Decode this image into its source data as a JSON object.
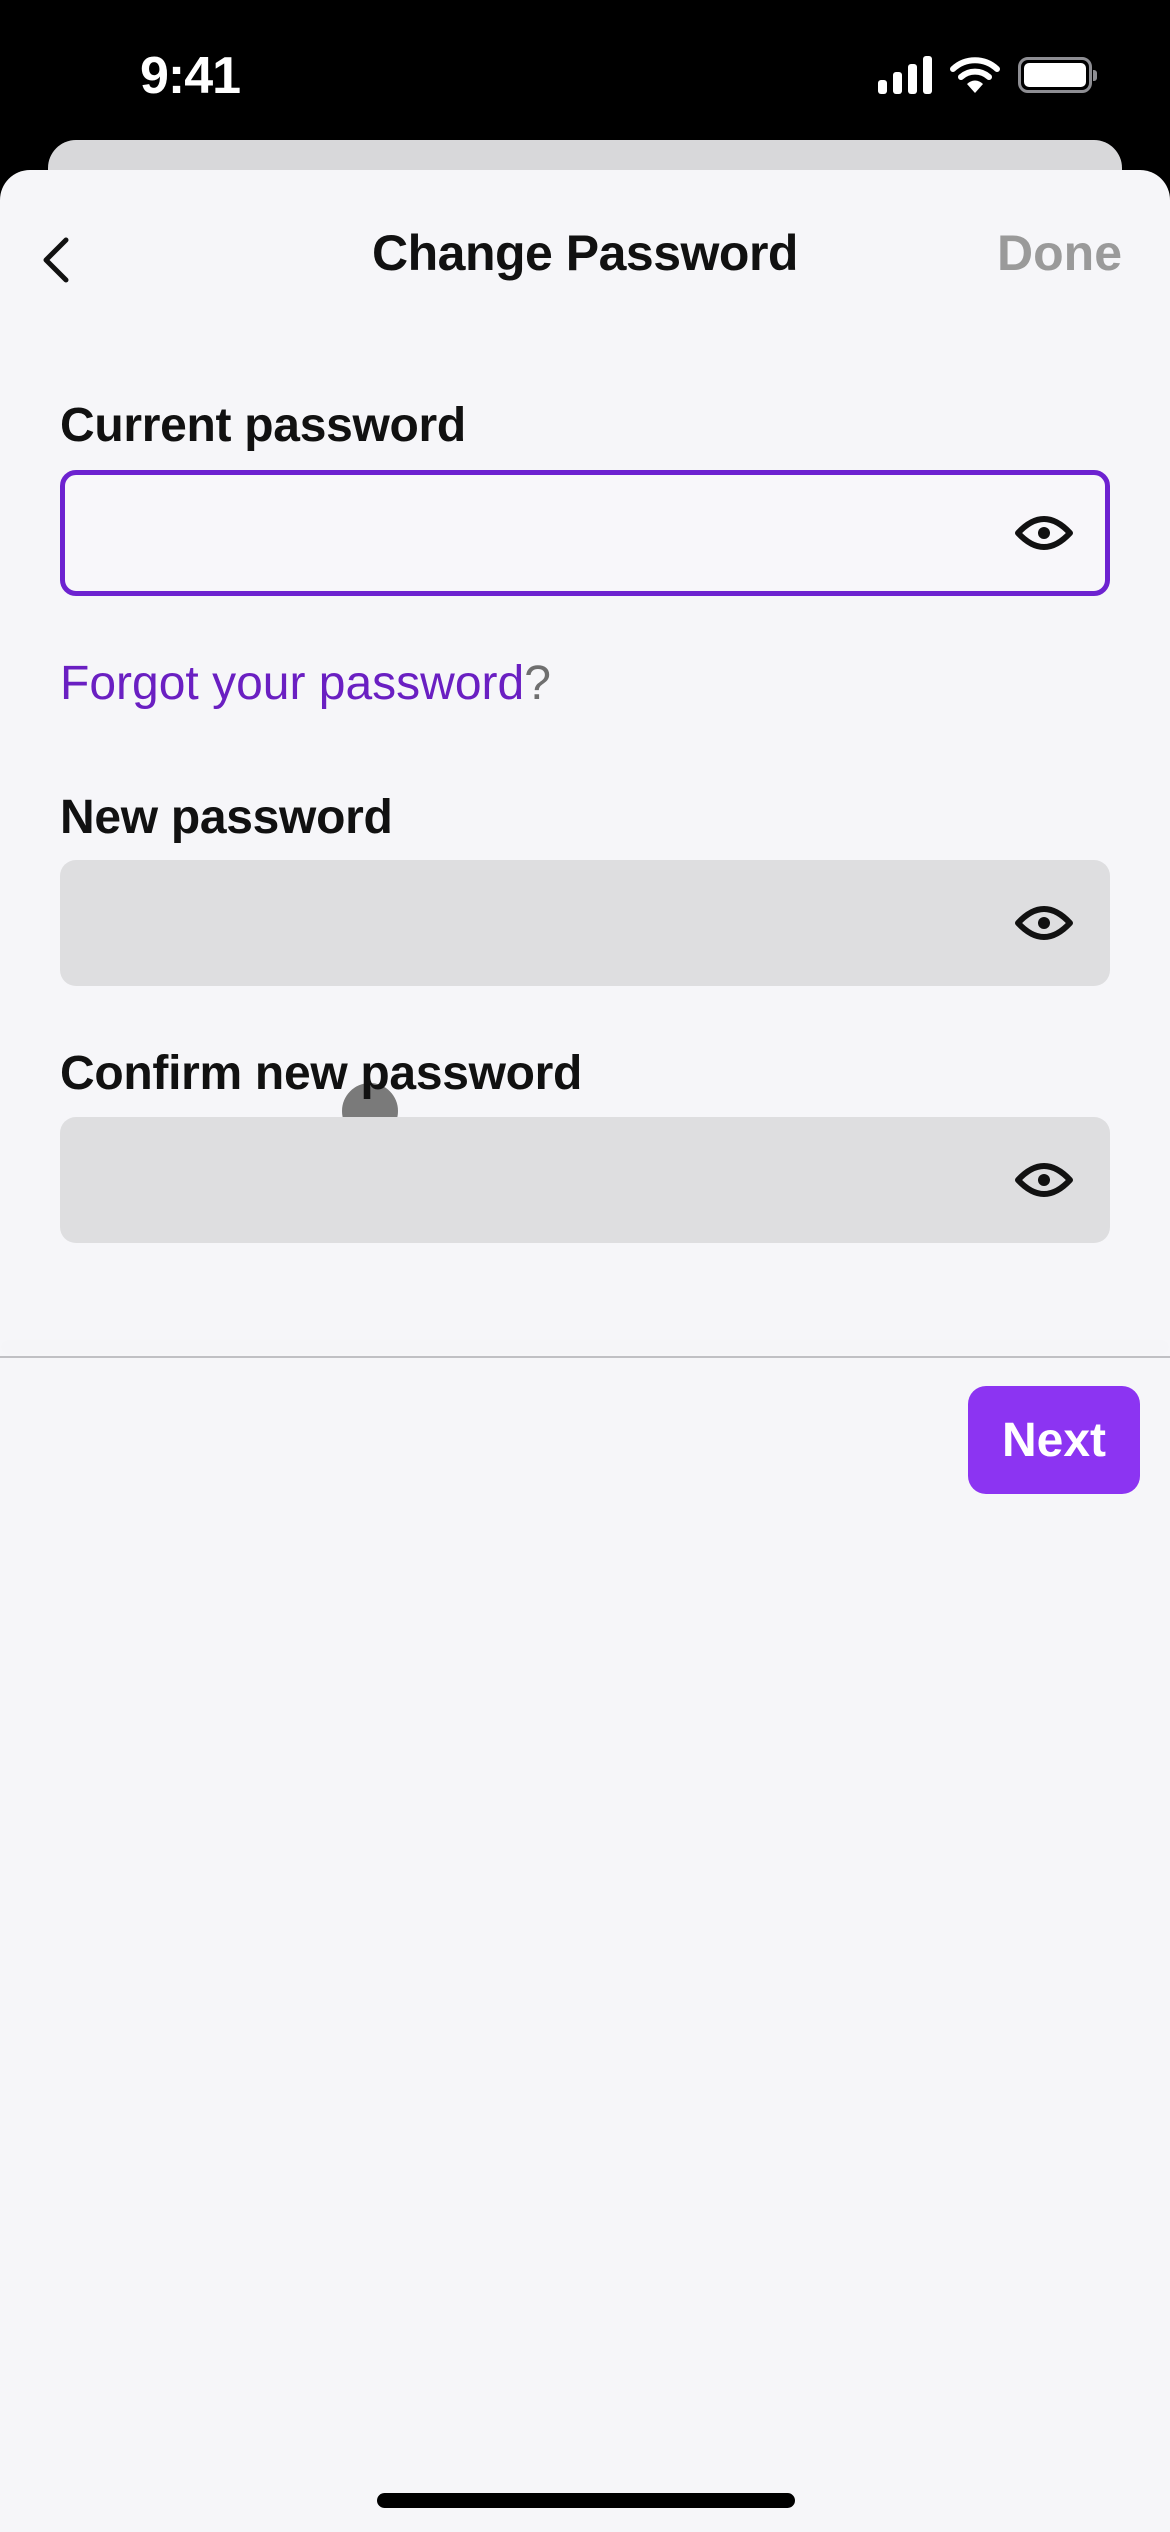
{
  "status_bar": {
    "time": "9:41",
    "icons": [
      "cellular-signal-icon",
      "wifi-icon",
      "battery-icon"
    ]
  },
  "nav": {
    "back_icon": "chevron-left-icon",
    "title": "Change Password",
    "done_label": "Done"
  },
  "form": {
    "current_password": {
      "label": "Current password",
      "value": "",
      "state": "focused",
      "toggle_icon": "eye-icon"
    },
    "forgot_link": {
      "text": "Forgot your password",
      "suffix": "?"
    },
    "new_password": {
      "label": "New password",
      "value": "",
      "state": "disabled",
      "toggle_icon": "eye-icon"
    },
    "confirm_password": {
      "label": "Confirm new password",
      "value": "",
      "state": "disabled",
      "toggle_icon": "eye-icon"
    }
  },
  "footer": {
    "next_label": "Next"
  },
  "colors": {
    "accent": "#8c34f2",
    "focus_border": "#6d22d0",
    "link": "#6a1fc2",
    "disabled_text": "#9a9a9a",
    "sheet_bg": "#f6f6f9",
    "disabled_input_bg": "#dedee0"
  }
}
